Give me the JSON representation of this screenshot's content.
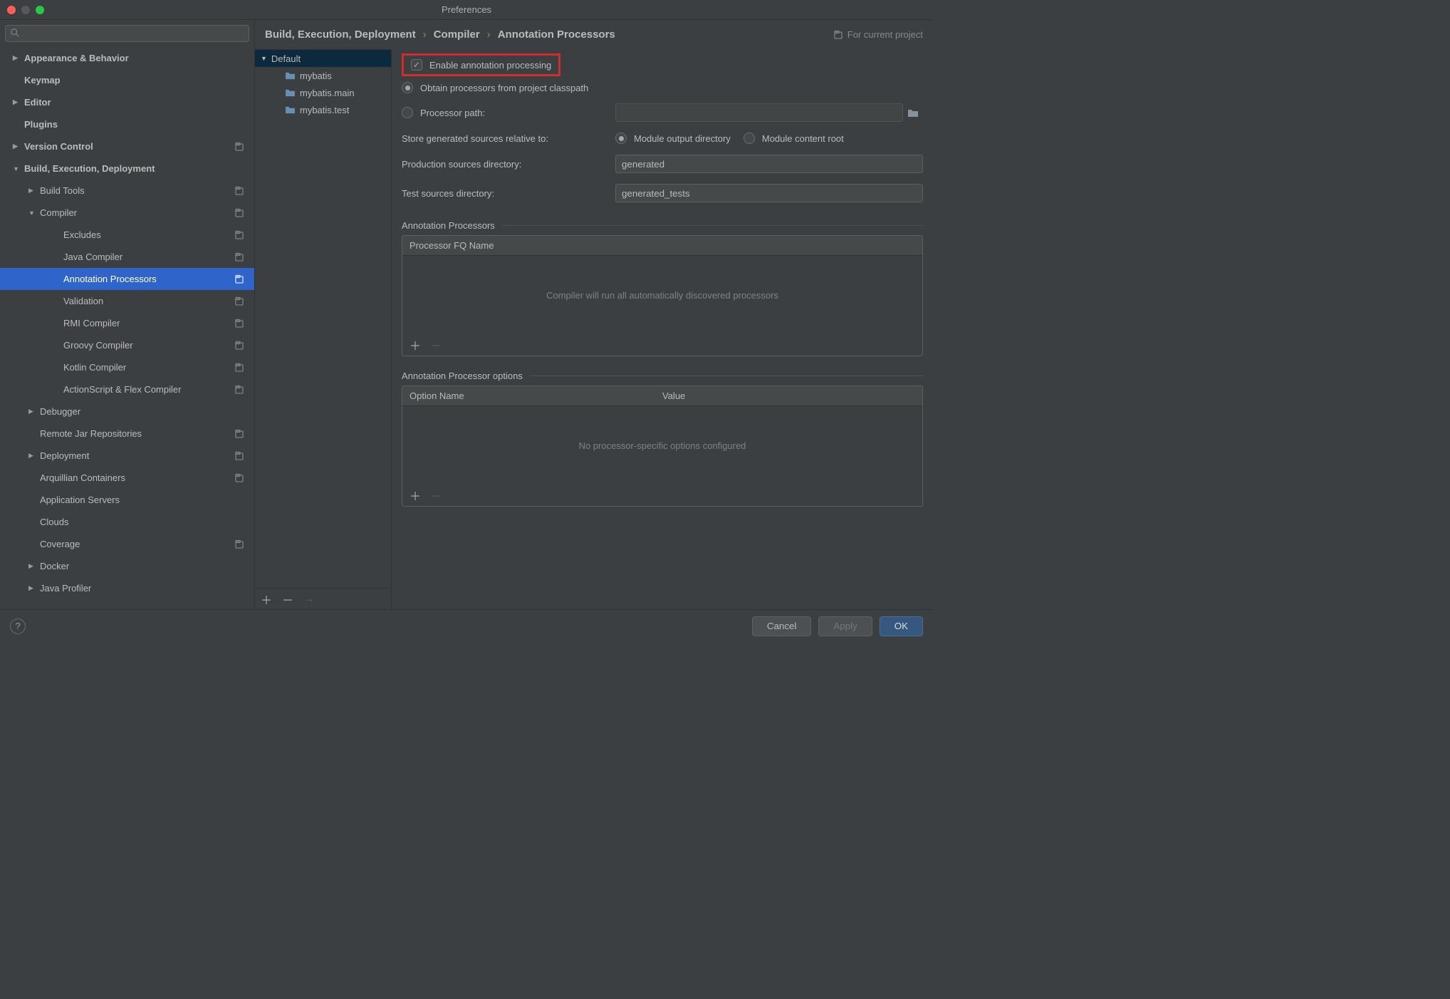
{
  "window": {
    "title": "Preferences"
  },
  "search": {
    "placeholder": ""
  },
  "sidebar": {
    "items": [
      {
        "label": "Appearance & Behavior",
        "depth": 0,
        "arrow": "▶",
        "proj": false
      },
      {
        "label": "Keymap",
        "depth": 0,
        "arrow": "",
        "proj": false
      },
      {
        "label": "Editor",
        "depth": 0,
        "arrow": "▶",
        "proj": false
      },
      {
        "label": "Plugins",
        "depth": 0,
        "arrow": "",
        "proj": false
      },
      {
        "label": "Version Control",
        "depth": 0,
        "arrow": "▶",
        "proj": true
      },
      {
        "label": "Build, Execution, Deployment",
        "depth": 0,
        "arrow": "▼",
        "proj": false
      },
      {
        "label": "Build Tools",
        "depth": 1,
        "arrow": "▶",
        "proj": true
      },
      {
        "label": "Compiler",
        "depth": 1,
        "arrow": "▼",
        "proj": true
      },
      {
        "label": "Excludes",
        "depth": 2,
        "arrow": "",
        "proj": true
      },
      {
        "label": "Java Compiler",
        "depth": 2,
        "arrow": "",
        "proj": true
      },
      {
        "label": "Annotation Processors",
        "depth": 2,
        "arrow": "",
        "proj": true,
        "selected": true
      },
      {
        "label": "Validation",
        "depth": 2,
        "arrow": "",
        "proj": true
      },
      {
        "label": "RMI Compiler",
        "depth": 2,
        "arrow": "",
        "proj": true
      },
      {
        "label": "Groovy Compiler",
        "depth": 2,
        "arrow": "",
        "proj": true
      },
      {
        "label": "Kotlin Compiler",
        "depth": 2,
        "arrow": "",
        "proj": true
      },
      {
        "label": "ActionScript & Flex Compiler",
        "depth": 2,
        "arrow": "",
        "proj": true
      },
      {
        "label": "Debugger",
        "depth": 1,
        "arrow": "▶",
        "proj": false
      },
      {
        "label": "Remote Jar Repositories",
        "depth": 1,
        "arrow": "",
        "proj": true
      },
      {
        "label": "Deployment",
        "depth": 1,
        "arrow": "▶",
        "proj": true
      },
      {
        "label": "Arquillian Containers",
        "depth": 1,
        "arrow": "",
        "proj": true
      },
      {
        "label": "Application Servers",
        "depth": 1,
        "arrow": "",
        "proj": false
      },
      {
        "label": "Clouds",
        "depth": 1,
        "arrow": "",
        "proj": false
      },
      {
        "label": "Coverage",
        "depth": 1,
        "arrow": "",
        "proj": true
      },
      {
        "label": "Docker",
        "depth": 1,
        "arrow": "▶",
        "proj": false
      },
      {
        "label": "Java Profiler",
        "depth": 1,
        "arrow": "▶",
        "proj": false
      }
    ]
  },
  "breadcrumb": {
    "p0": "Build, Execution, Deployment",
    "p1": "Compiler",
    "p2": "Annotation Processors",
    "hint": "For current project"
  },
  "mid": {
    "root": "Default",
    "children": [
      "mybatis",
      "mybatis.main",
      "mybatis.test"
    ]
  },
  "form": {
    "enable_label": "Enable annotation processing",
    "obtain_label": "Obtain processors from project classpath",
    "procpath_label": "Processor path:",
    "procpath_value": "",
    "store_label": "Store generated sources relative to:",
    "store_opt1": "Module output directory",
    "store_opt2": "Module content root",
    "prod_label": "Production sources directory:",
    "prod_value": "generated",
    "test_label": "Test sources directory:",
    "test_value": "generated_tests"
  },
  "proc_group": {
    "title": "Annotation Processors",
    "col1": "Processor FQ Name",
    "empty": "Compiler will run all automatically discovered processors"
  },
  "opt_group": {
    "title": "Annotation Processor options",
    "col1": "Option Name",
    "col2": "Value",
    "empty": "No processor-specific options configured"
  },
  "footer": {
    "cancel": "Cancel",
    "apply": "Apply",
    "ok": "OK"
  }
}
